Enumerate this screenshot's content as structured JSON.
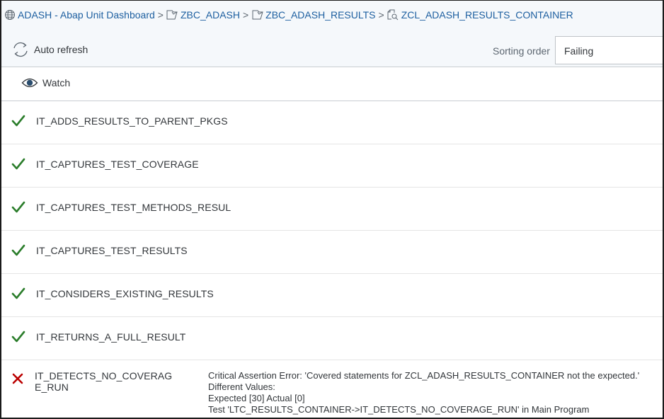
{
  "breadcrumb": {
    "items": [
      {
        "label": "ADASH - Abap Unit Dashboard",
        "icon": "globe-icon"
      },
      {
        "label": "ZBC_ADASH",
        "icon": "package-icon"
      },
      {
        "label": "ZBC_ADASH_RESULTS",
        "icon": "package-icon"
      },
      {
        "label": "ZCL_ADASH_RESULTS_CONTAINER",
        "icon": "class-search-icon"
      }
    ],
    "separator": ">"
  },
  "toolbar": {
    "auto_refresh_label": "Auto refresh",
    "sorting_label": "Sorting order",
    "sorting_value": "Failing",
    "watch_label": "Watch"
  },
  "tests": [
    {
      "name": "IT_ADDS_RESULTS_TO_PARENT_PKGS",
      "status": "passed"
    },
    {
      "name": "IT_CAPTURES_TEST_COVERAGE",
      "status": "passed"
    },
    {
      "name": "IT_CAPTURES_TEST_METHODS_RESUL",
      "status": "passed"
    },
    {
      "name": "IT_CAPTURES_TEST_RESULTS",
      "status": "passed"
    },
    {
      "name": "IT_CONSIDERS_EXISTING_RESULTS",
      "status": "passed"
    },
    {
      "name": "IT_RETURNS_A_FULL_RESULT",
      "status": "passed"
    },
    {
      "name": "IT_DETECTS_NO_COVERAGE_RUN",
      "status": "failed",
      "message": [
        "Critical Assertion Error: 'Covered statements for ZCL_ADASH_RESULTS_CONTAINER not the expected.'",
        "Different Values:",
        "Expected [30] Actual [0]",
        "Test 'LTC_RESULTS_CONTAINER->IT_DETECTS_NO_COVERAGE_RUN' in Main Program"
      ]
    }
  ],
  "colors": {
    "link": "#1d5fa0",
    "passed": "#2b7d2b",
    "failed": "#bb0000",
    "header_bg": "#f5f8fb"
  }
}
